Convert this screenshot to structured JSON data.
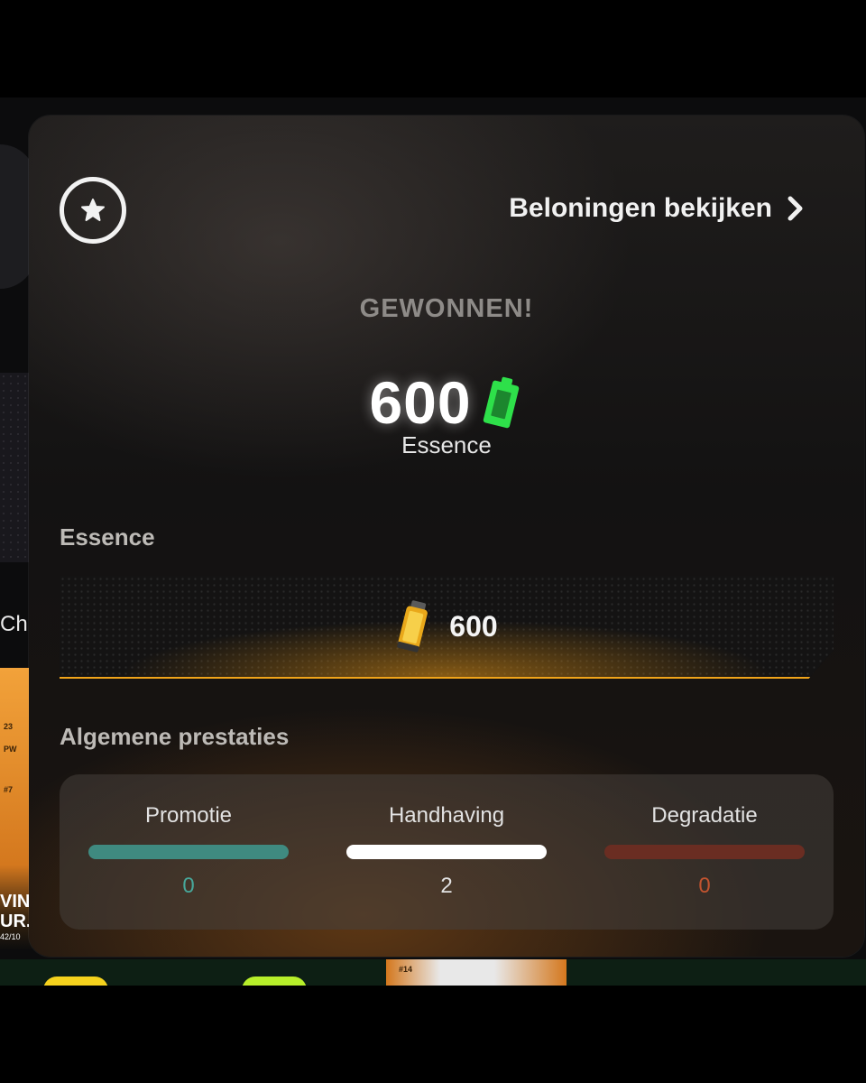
{
  "background": {
    "partial_text": "Ch",
    "card_text_lines": [
      "VIN",
      "UR."
    ],
    "card_small_text": [
      "23",
      "PW",
      "#7"
    ],
    "card_bottom_text": "42/10",
    "player_card_number": "#14"
  },
  "panel": {
    "rewards_link": "Beloningen bekijken",
    "won_title": "GEWONNEN!",
    "amount": "600",
    "amount_unit": "Essence",
    "essence_section_label": "Essence",
    "essence_value": "600",
    "performance_section_label": "Algemene prestaties",
    "stats": [
      {
        "label": "Promotie",
        "value": "0",
        "color": "#3f8a80",
        "text_color": "#47a79a"
      },
      {
        "label": "Handhaving",
        "value": "2",
        "color": "#ffffff",
        "text_color": "#e2e2e2"
      },
      {
        "label": "Degradatie",
        "value": "0",
        "color": "#6a2d22",
        "text_color": "#c2542f"
      }
    ]
  },
  "colors": {
    "accent_green": "#2ee04a",
    "accent_orange": "#f0a41a"
  }
}
